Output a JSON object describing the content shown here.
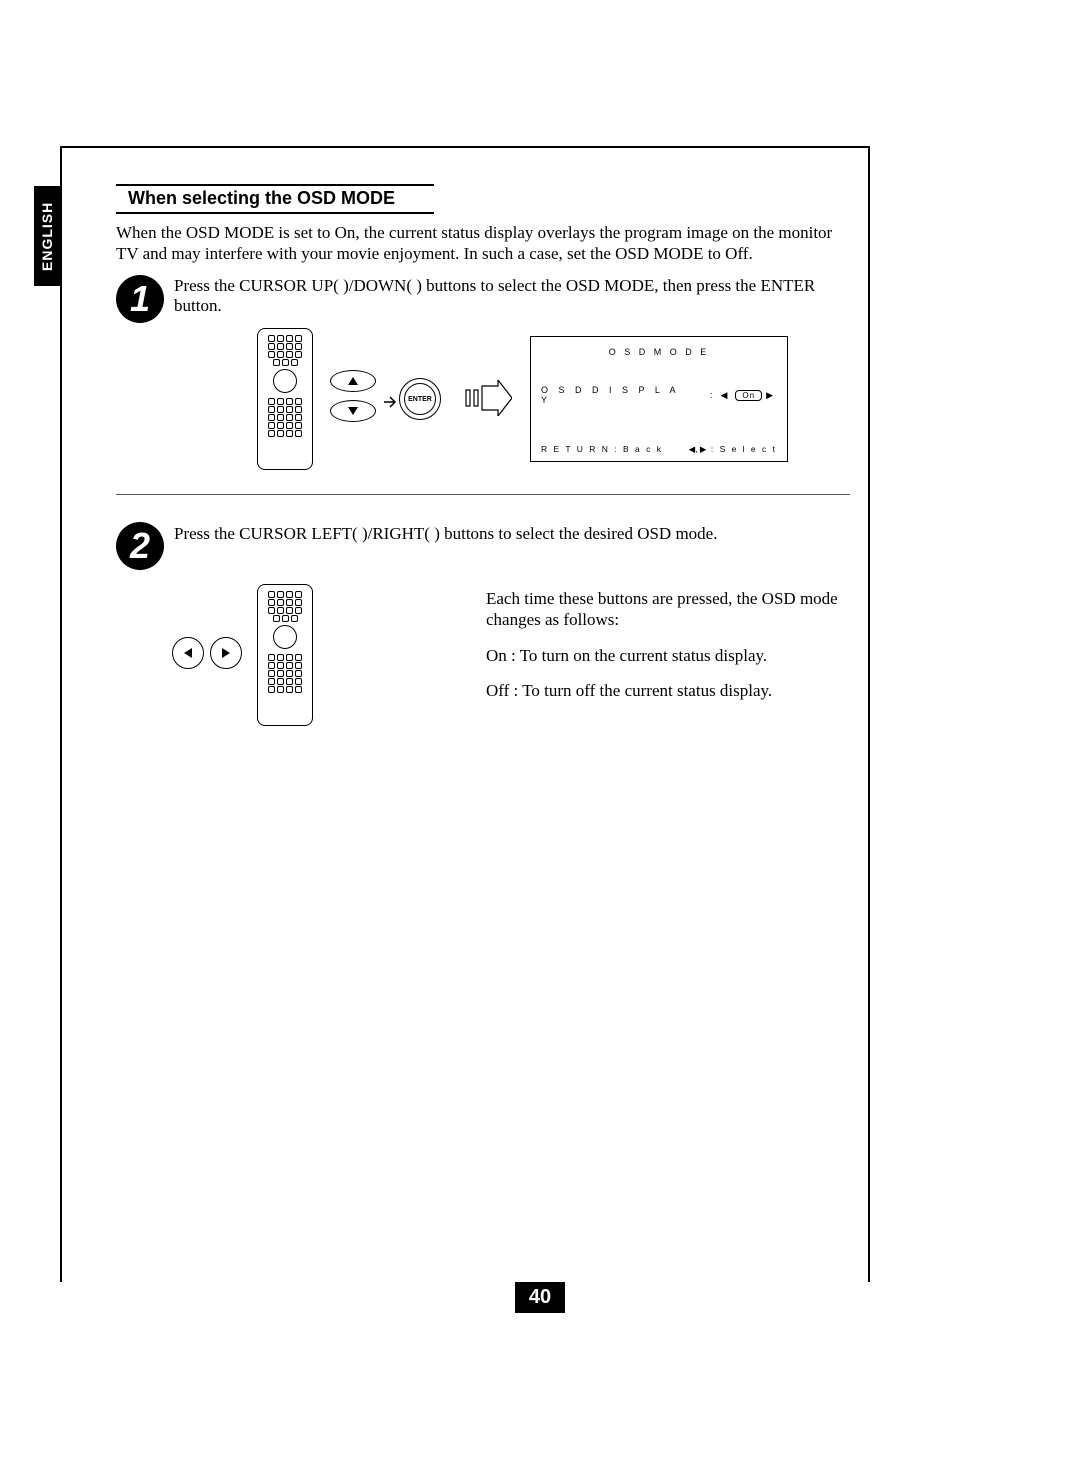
{
  "language_tab": "ENGLISH",
  "section_title": "When selecting the OSD MODE",
  "intro": "When the OSD MODE is set to On, the current status display overlays the program image on the monitor TV and may interfere with your movie enjoyment. In such a case, set the OSD MODE to Off.",
  "step1": {
    "number": "1",
    "text": "Press the CURSOR UP(    )/DOWN(    ) buttons to select the OSD MODE, then press the ENTER button.",
    "enter_label": "ENTER"
  },
  "osd": {
    "title": "O S D   M O D E",
    "display_label": "O S D   D I S P L A Y",
    "colon": ":",
    "value": "On",
    "return_label": "R E T U R N : B a c k",
    "select_label": ": S e l e c t"
  },
  "step2": {
    "number": "2",
    "text": "Press the CURSOR LEFT(    )/RIGHT(    ) buttons to select the desired OSD mode.",
    "desc_line1": "Each time these buttons are pressed, the OSD mode changes as follows:",
    "desc_on": "On : To turn on the current status display.",
    "desc_off": "Off : To turn off the current status display."
  },
  "page_number": "40"
}
